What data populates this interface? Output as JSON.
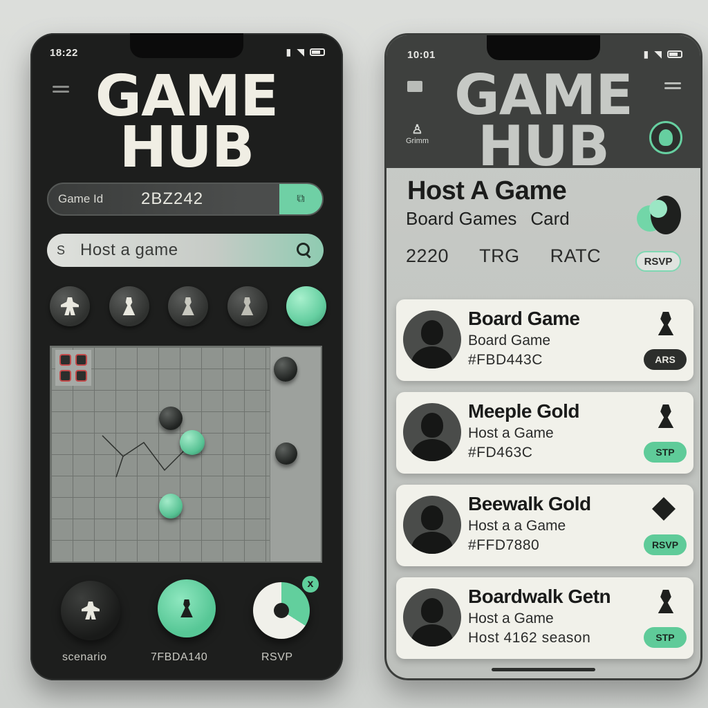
{
  "left": {
    "status_time": "18:22",
    "logo": "GAME HUB",
    "game_id": {
      "label": "Game Id",
      "value": "2BZ242",
      "button_icon": "clipboard-icon"
    },
    "search": {
      "prefix": "S",
      "placeholder": "Host a game"
    },
    "tokens": [
      "meeple-icon",
      "pawn-icon",
      "pawn-icon",
      "pawn-icon",
      "mint-token"
    ],
    "actions": [
      {
        "label": "scenario",
        "icon": "meeple-icon"
      },
      {
        "label": "7FBDA140",
        "icon": "pawn-icon"
      },
      {
        "label": "RSVP",
        "icon": "target-icon",
        "badge": "x"
      }
    ]
  },
  "right": {
    "status_time": "10:01",
    "logo": "GAME HUB",
    "user_label": "Grimm",
    "title": "Host A Game",
    "subtitle": [
      "Board Games",
      "Card"
    ],
    "filters": [
      "2220",
      "TRG",
      "RATC"
    ],
    "rsvp_pill": "RSVP",
    "cards": [
      {
        "title": "Board Game",
        "line1": "Board Game",
        "line2": "#FBD443C",
        "button": "ARS",
        "button_style": "dark",
        "icon": "pawn-icon"
      },
      {
        "title": "Meeple Gold",
        "line1": "Host a Game",
        "line2": "#FD463C",
        "button": "STP",
        "button_style": "mint",
        "icon": "pawn-icon"
      },
      {
        "title": "Beewalk Gold",
        "line1": "Host a a Game",
        "line2": "#FFD7880",
        "button": "RSVP",
        "button_style": "mint",
        "icon": "diamond-icon"
      },
      {
        "title": "Boardwalk Getn",
        "line1": "Host a Game",
        "line2": "Host 4162 season",
        "button": "STP",
        "button_style": "mint",
        "icon": "pawn-icon"
      }
    ]
  },
  "colors": {
    "accent": "#66cfa0",
    "dark": "#1d1e1d",
    "light": "#f1f1ea"
  }
}
